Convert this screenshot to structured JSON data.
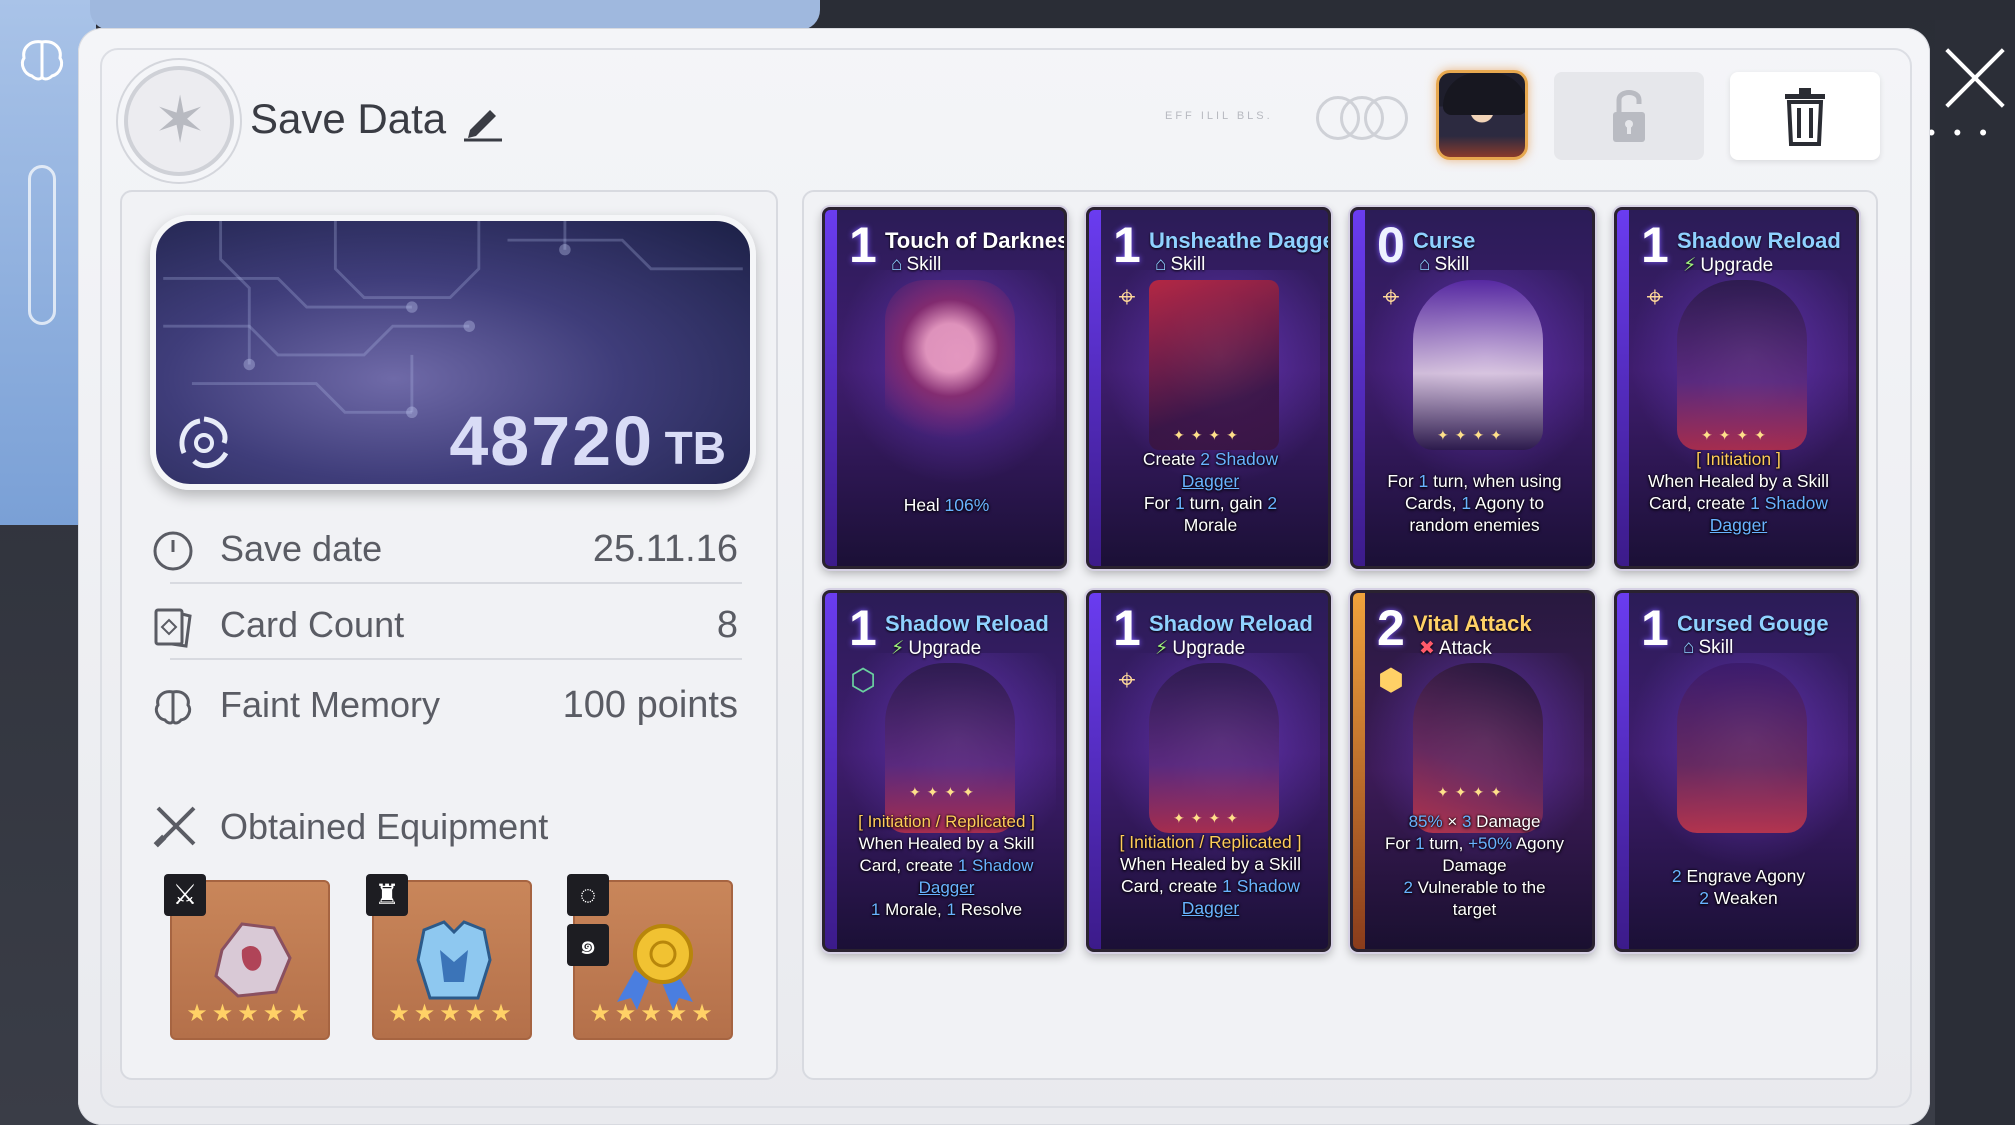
{
  "header": {
    "title": "Save Data",
    "tiny_text": "EFF ILIL BLS."
  },
  "storage": {
    "value": "48720",
    "unit": "TB"
  },
  "info": [
    {
      "label": "Save date",
      "value": "25.11.16",
      "icon": "clock-icon"
    },
    {
      "label": "Card Count",
      "value": "8",
      "icon": "card-icon"
    },
    {
      "label": "Faint Memory",
      "value": "100 points",
      "icon": "brain-icon"
    }
  ],
  "equipment": {
    "title": "Obtained Equipment",
    "items": [
      {
        "name": "crystal-ore",
        "stars": "★★★★★",
        "tag_icon": "sword-icon"
      },
      {
        "name": "armor",
        "stars": "★★★★★",
        "tag_icon": "armor-icon"
      },
      {
        "name": "medal",
        "stars": "★★★★★",
        "tag_icon": "ring-icon"
      }
    ]
  },
  "cards": [
    {
      "cost": "1",
      "name": "Touch of Darkness",
      "type": "Skill",
      "type_icon": "skill-icon",
      "desc_line1": "Heal ",
      "desc_hl": "106%",
      "kind": "skill"
    },
    {
      "cost": "1",
      "name": "Unsheathe Dagger",
      "type": "Skill",
      "type_icon": "skill-icon",
      "kind": "skill"
    },
    {
      "cost": "0",
      "name": "Curse",
      "type": "Skill",
      "type_icon": "skill-icon",
      "kind": "skill"
    },
    {
      "cost": "1",
      "name": "Shadow Reload",
      "type": "Upgrade",
      "type_icon": "upgrade-icon",
      "kind": "upgrade"
    },
    {
      "cost": "1",
      "name": "Shadow Reload",
      "type": "Upgrade",
      "type_icon": "upgrade-icon",
      "kind": "upgrade"
    },
    {
      "cost": "1",
      "name": "Shadow Reload",
      "type": "Upgrade",
      "type_icon": "upgrade-icon",
      "kind": "upgrade"
    },
    {
      "cost": "2",
      "name": "Vital Attack",
      "type": "Attack",
      "type_icon": "attack-icon",
      "kind": "attack"
    },
    {
      "cost": "1",
      "name": "Cursed Gouge",
      "type": "Skill",
      "type_icon": "skill-icon",
      "kind": "skill"
    }
  ],
  "card_text": {
    "c1": {
      "a": "Heal ",
      "b": "106%"
    },
    "c2": {
      "a": "Create ",
      "b": "2",
      "c": " Shadow",
      "d": "Dagger",
      "e": "For ",
      "f": "1",
      "g": " turn, gain ",
      "h": "2",
      "i": "Morale"
    },
    "c3": {
      "a": "For ",
      "b": "1",
      "c": " turn, when using",
      "d": "Cards, ",
      "e": "1",
      "f": " Agony to",
      "g": "random enemies"
    },
    "c4": {
      "tag": "[ Initiation ]",
      "a": "When Healed by a Skill",
      "b": "Card, create ",
      "c": "1",
      "d": " Shadow",
      "e": "Dagger"
    },
    "c5": {
      "tag": "[ Initiation / Replicated ]",
      "a": "When Healed by a Skill",
      "b": "Card, create ",
      "c": "1",
      "d": " Shadow",
      "e": "Dagger",
      "f": "1",
      "g": " Morale, ",
      "h": "1",
      "i": " Resolve"
    },
    "c6": {
      "tag": "[ Initiation / Replicated ]",
      "a": "When Healed by a Skill",
      "b": "Card, create ",
      "c": "1",
      "d": " Shadow",
      "e": "Dagger"
    },
    "c7": {
      "a": "85%",
      "b": " × ",
      "c": "3",
      "d": " Damage",
      "e": "For ",
      "f": "1",
      "g": " turn, ",
      "h": "+50%",
      "i": " Agony",
      "j": "Damage",
      "k": "2",
      "l": " Vulnerable to the",
      "m": "target"
    },
    "c8": {
      "a": "2",
      "b": " Engrave Agony",
      "c": "2",
      "d": " Weaken"
    }
  },
  "colors": {
    "accent_blue": "#69b3ff",
    "tag_gold": "#ffcd58",
    "panel_bg": "#f1f2f5"
  }
}
